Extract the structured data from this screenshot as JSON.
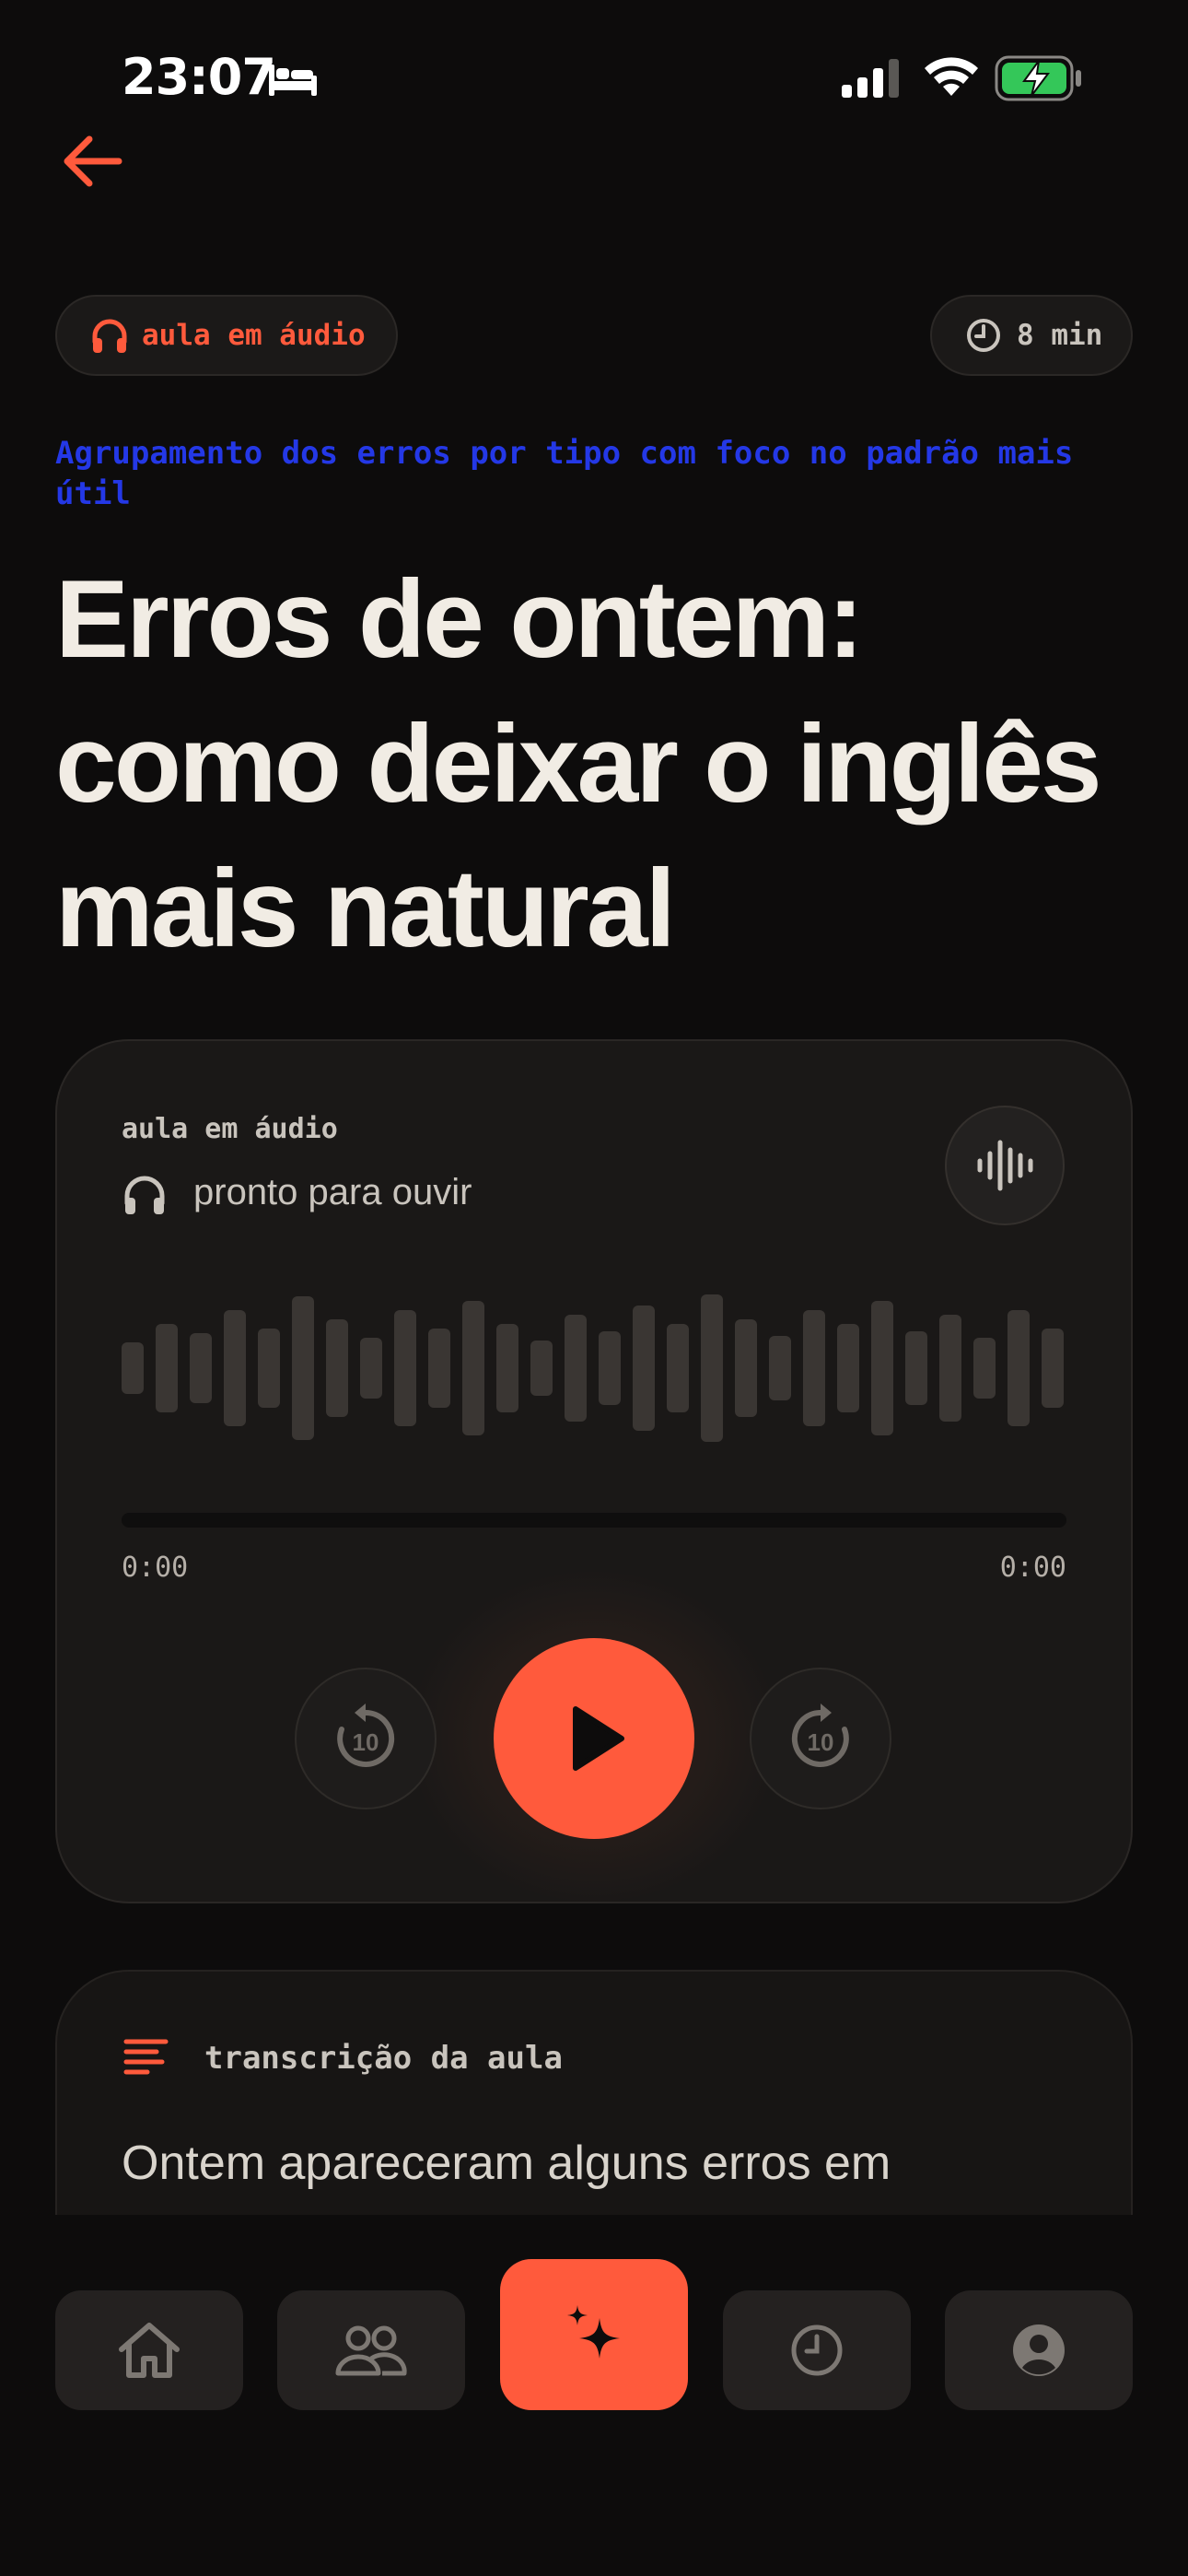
{
  "status_bar": {
    "time": "23:07"
  },
  "header": {
    "badge_label": "aula em áudio",
    "duration_label": "8 min",
    "subtitle": "Agrupamento dos erros por tipo com foco no padrão mais útil",
    "title": "Erros de ontem: como deixar o inglês mais natural"
  },
  "player": {
    "label": "aula em áudio",
    "status": "pronto para ouvir",
    "current_time": "0:00",
    "total_time": "0:00",
    "progress": 0,
    "skip_back_seconds": "10",
    "skip_forward_seconds": "10"
  },
  "transcript": {
    "label": "transcrição da aula",
    "text": "Ontem apareceram alguns erros em"
  },
  "colors": {
    "accent": "#ff5a3c",
    "subtitle": "#2438e6",
    "background": "#0d0c0c",
    "battery": "#34c759"
  },
  "icons": {
    "back": "arrow-left-icon",
    "badge": "headphones-icon",
    "duration": "clock-icon",
    "waveform_button": "waveform-icon",
    "play": "play-icon",
    "skip_back": "rotate-ccw-10-icon",
    "skip_forward": "rotate-cw-10-icon",
    "transcript": "text-lines-icon",
    "nav": [
      "home-icon",
      "people-icon",
      "sparkles-icon",
      "clock-icon",
      "user-circle-icon"
    ]
  }
}
